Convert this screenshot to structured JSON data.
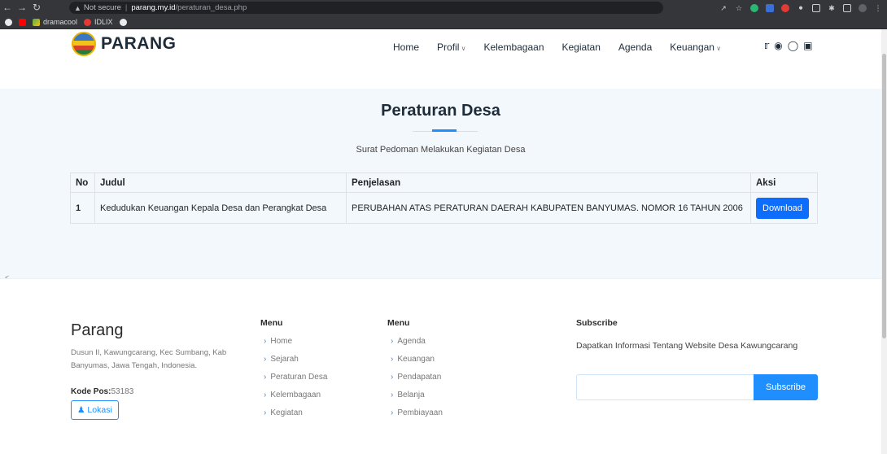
{
  "browser": {
    "security_label": "Not secure",
    "host": "parang.my.id",
    "path": "/peraturan_desa.php",
    "bookmarks": [
      {
        "label": "dramacool"
      },
      {
        "label": "IDLIX"
      }
    ]
  },
  "header": {
    "brand": "PARANG",
    "nav": [
      {
        "label": "Home"
      },
      {
        "label": "Profil",
        "dropdown": true
      },
      {
        "label": "Kelembagaan"
      },
      {
        "label": "Kegiatan"
      },
      {
        "label": "Agenda"
      },
      {
        "label": "Keuangan",
        "dropdown": true
      }
    ],
    "social_icons": [
      "twitter-icon",
      "facebook-icon",
      "instagram-icon",
      "linkedin-icon"
    ]
  },
  "hero": {
    "title": "Peraturan Desa",
    "subtitle": "Surat Pedoman Melakukan Kegiatan Desa"
  },
  "table": {
    "headers": {
      "no": "No",
      "judul": "Judul",
      "penjelasan": "Penjelasan",
      "aksi": "Aksi"
    },
    "rows": [
      {
        "no": "1",
        "judul": "Kedudukan Keuangan Kepala Desa dan Perangkat Desa",
        "penjelasan": "PERUBAHAN ATAS PERATURAN DAERAH KABUPATEN BANYUMAS. NOMOR 16 TAHUN 2006",
        "action_label": "Download"
      }
    ]
  },
  "footer": {
    "brand": "Parang",
    "address": "Dusun II, Kawungcarang, Kec Sumbang, Kab Banyumas, Jawa Tengah, Indonesia.",
    "kode_pos_label": "Kode Pos:",
    "kode_pos_value": "53183",
    "lokasi_label": "Lokasi",
    "menu1": {
      "title": "Menu",
      "items": [
        "Home",
        "Sejarah",
        "Peraturan Desa",
        "Kelembagaan",
        "Kegiatan"
      ]
    },
    "menu2": {
      "title": "Menu",
      "items": [
        "Agenda",
        "Keuangan",
        "Pendapatan",
        "Belanja",
        "Pembiayaan"
      ]
    },
    "subscribe": {
      "title": "Subscribe",
      "text": "Dapatkan Informasi Tentang Website Desa Kawungcarang",
      "input_value": "",
      "button_label": "Subscribe"
    }
  },
  "colors": {
    "accent": "#1f8fff",
    "download_button": "#0d6efd",
    "band_background": "#f3f8fc"
  }
}
